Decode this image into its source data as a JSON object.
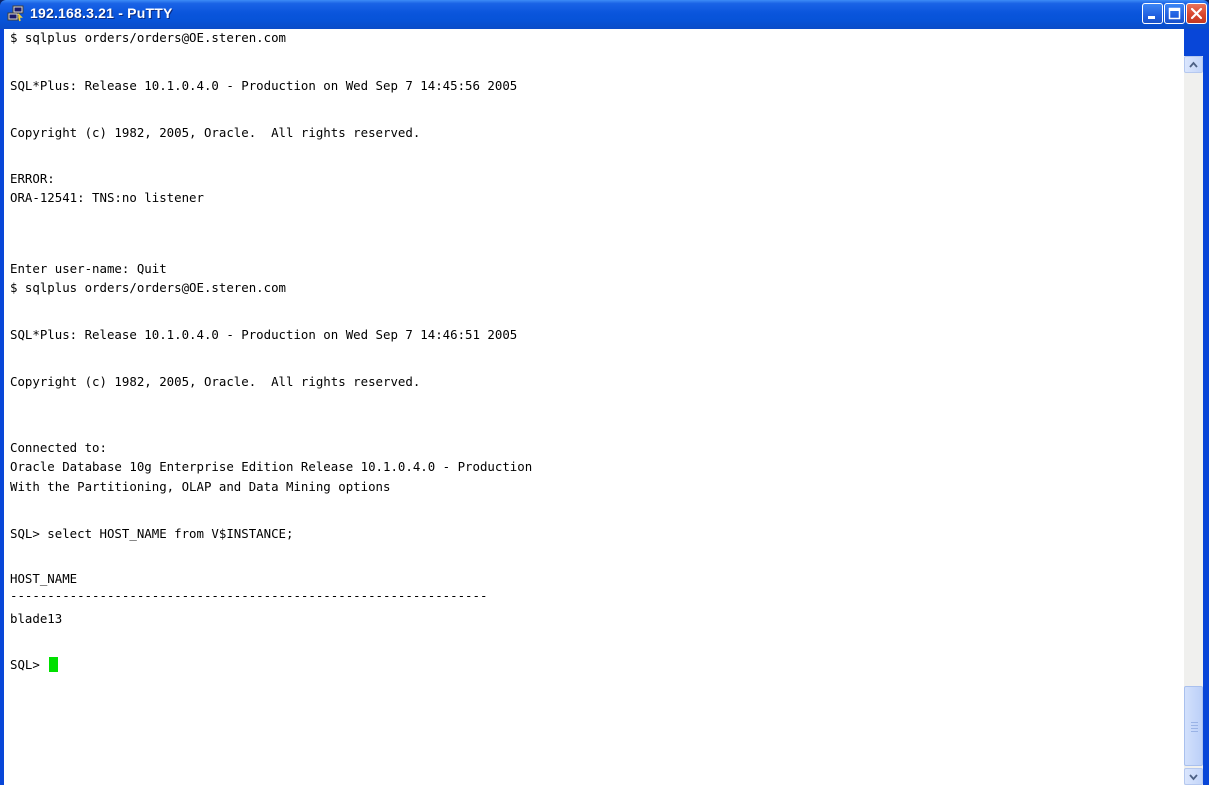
{
  "window": {
    "title": "192.168.3.21 - PuTTY",
    "icon": "putty-icon",
    "controls": [
      "minimize-icon",
      "maximize-icon",
      "close-icon"
    ]
  },
  "terminal": {
    "lines": [
      "$ sqlplus orders/orders@OE.steren.com",
      "",
      "SQL*Plus: Release 10.1.0.4.0 - Production on Wed Sep 7 14:45:56 2005",
      "",
      "Copyright (c) 1982, 2005, Oracle.  All rights reserved.",
      "",
      "ERROR:",
      "ORA-12541: TNS:no listener",
      "",
      "",
      "Enter user-name: Quit",
      "$ sqlplus orders/orders@OE.steren.com",
      "",
      "SQL*Plus: Release 10.1.0.4.0 - Production on Wed Sep 7 14:46:51 2005",
      "",
      "Copyright (c) 1982, 2005, Oracle.  All rights reserved.",
      "",
      "",
      "Connected to:",
      "Oracle Database 10g Enterprise Edition Release 10.1.0.4.0 - Production",
      "With the Partitioning, OLAP and Data Mining options",
      "",
      "SQL> select HOST_NAME from V$INSTANCE;",
      "",
      "HOST_NAME",
      "----------------------------------------------------------------",
      "blade13",
      "",
      "SQL> "
    ],
    "cursor_color": "#00e000"
  },
  "colors": {
    "title_bar": "#0a55dc",
    "terminal_bg": "#ffffff",
    "terminal_fg": "#000000"
  }
}
